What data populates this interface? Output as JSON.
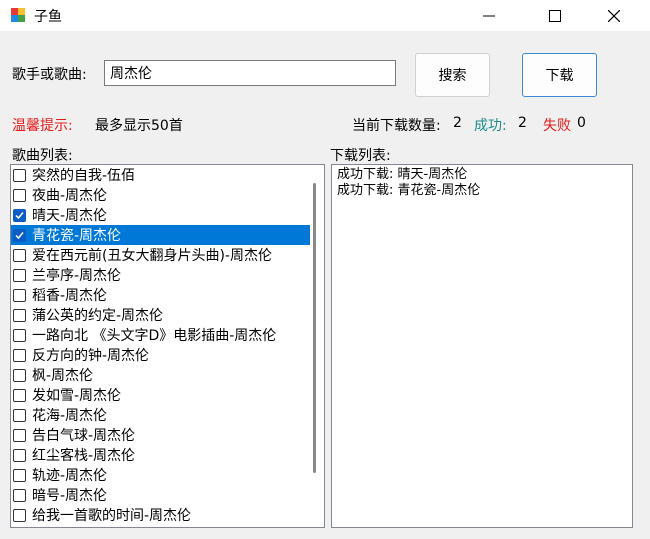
{
  "window": {
    "title": "子鱼",
    "controls": [
      "minimize",
      "maximize",
      "close"
    ]
  },
  "search": {
    "label": "歌手或歌曲:",
    "value": "周杰伦",
    "search_button": "搜索",
    "download_button": "下载"
  },
  "tip": {
    "label": "温馨提示:",
    "text": "最多显示50首",
    "label_color": "#e51b1b"
  },
  "stats": {
    "count_label": "当前下载数量:",
    "count_value": "2",
    "success_label": "成功:",
    "success_value": "2",
    "fail_label": "失败",
    "fail_value": "0",
    "success_color": "#1f8a8a",
    "fail_color": "#e51b1b"
  },
  "song_list": {
    "label": "歌曲列表:",
    "selection_color": "#0078d7",
    "items": [
      {
        "text": "突然的自我-伍佰",
        "checked": false,
        "selected": false
      },
      {
        "text": "夜曲-周杰伦",
        "checked": false,
        "selected": false
      },
      {
        "text": "晴天-周杰伦",
        "checked": true,
        "selected": false
      },
      {
        "text": "青花瓷-周杰伦",
        "checked": true,
        "selected": true
      },
      {
        "text": "爱在西元前(丑女大翻身片头曲)-周杰伦",
        "checked": false,
        "selected": false
      },
      {
        "text": "兰亭序-周杰伦",
        "checked": false,
        "selected": false
      },
      {
        "text": "稻香-周杰伦",
        "checked": false,
        "selected": false
      },
      {
        "text": "蒲公英的约定-周杰伦",
        "checked": false,
        "selected": false
      },
      {
        "text": "一路向北 《头文字D》电影插曲-周杰伦",
        "checked": false,
        "selected": false
      },
      {
        "text": "反方向的钟-周杰伦",
        "checked": false,
        "selected": false
      },
      {
        "text": "枫-周杰伦",
        "checked": false,
        "selected": false
      },
      {
        "text": "发如雪-周杰伦",
        "checked": false,
        "selected": false
      },
      {
        "text": "花海-周杰伦",
        "checked": false,
        "selected": false
      },
      {
        "text": "告白气球-周杰伦",
        "checked": false,
        "selected": false
      },
      {
        "text": "红尘客栈-周杰伦",
        "checked": false,
        "selected": false
      },
      {
        "text": "轨迹-周杰伦",
        "checked": false,
        "selected": false
      },
      {
        "text": "暗号-周杰伦",
        "checked": false,
        "selected": false
      },
      {
        "text": "给我一首歌的时间-周杰伦",
        "checked": false,
        "selected": false
      }
    ]
  },
  "download_list": {
    "label": "下载列表:",
    "lines": [
      "成功下载: 晴天-周杰伦",
      "成功下载: 青花瓷-周杰伦"
    ]
  }
}
